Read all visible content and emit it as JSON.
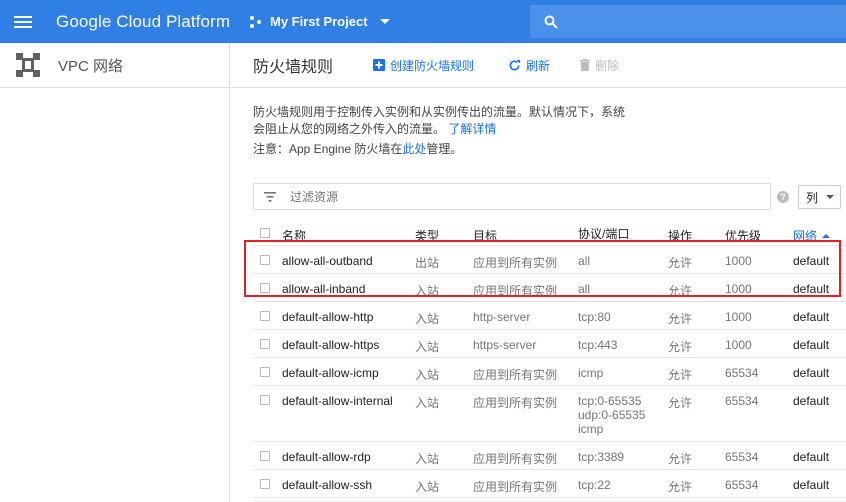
{
  "header": {
    "brand": "Google Cloud Platform",
    "project": "My First Project",
    "menu_icon": "hamburger-icon",
    "search_icon": "search-icon",
    "accent_color": "#2f7fe5"
  },
  "sidebar": {
    "title": "VPC 网络",
    "icon": "vpc-network-icon"
  },
  "toolbar": {
    "page_title": "防火墙规则",
    "create_label": "创建防火墙规则",
    "refresh_label": "刷新",
    "delete_label": "删除"
  },
  "description": {
    "text": "防火墙规则用于控制传入实例和从实例传出的流量。默认情况下，系统会阻止从您的网络之外传入的流量。",
    "learn_more": "了解详情",
    "note_prefix": "注意：App Engine 防火墙在",
    "note_link": "此处",
    "note_suffix": "管理。"
  },
  "filter": {
    "placeholder": "过滤资源",
    "columns_label": "列"
  },
  "table": {
    "columns": {
      "name": "名称",
      "type": "类型",
      "target": "目标",
      "protocol": "协议/端口",
      "action": "操作",
      "priority": "优先级",
      "network": "网络"
    },
    "rows": [
      {
        "name": "allow-all-outband",
        "type": "出站",
        "target": "应用到所有实例",
        "protocol": "all",
        "action": "允许",
        "priority": "1000",
        "network": "default"
      },
      {
        "name": "allow-all-inband",
        "type": "入站",
        "target": "应用到所有实例",
        "protocol": "all",
        "action": "允许",
        "priority": "1000",
        "network": "default"
      },
      {
        "name": "default-allow-http",
        "type": "入站",
        "target": "http-server",
        "protocol": "tcp:80",
        "action": "允许",
        "priority": "1000",
        "network": "default"
      },
      {
        "name": "default-allow-https",
        "type": "入站",
        "target": "https-server",
        "protocol": "tcp:443",
        "action": "允许",
        "priority": "1000",
        "network": "default"
      },
      {
        "name": "default-allow-icmp",
        "type": "入站",
        "target": "应用到所有实例",
        "protocol": "icmp",
        "action": "允许",
        "priority": "65534",
        "network": "default"
      },
      {
        "name": "default-allow-internal",
        "type": "入站",
        "target": "应用到所有实例",
        "protocol_lines": [
          "tcp:0-65535",
          "udp:0-65535",
          "icmp"
        ],
        "action": "允许",
        "priority": "65534",
        "network": "default"
      },
      {
        "name": "default-allow-rdp",
        "type": "入站",
        "target": "应用到所有实例",
        "protocol": "tcp:3389",
        "action": "允许",
        "priority": "65534",
        "network": "default"
      },
      {
        "name": "default-allow-ssh",
        "type": "入站",
        "target": "应用到所有实例",
        "protocol": "tcp:22",
        "action": "允许",
        "priority": "65534",
        "network": "default"
      }
    ]
  }
}
